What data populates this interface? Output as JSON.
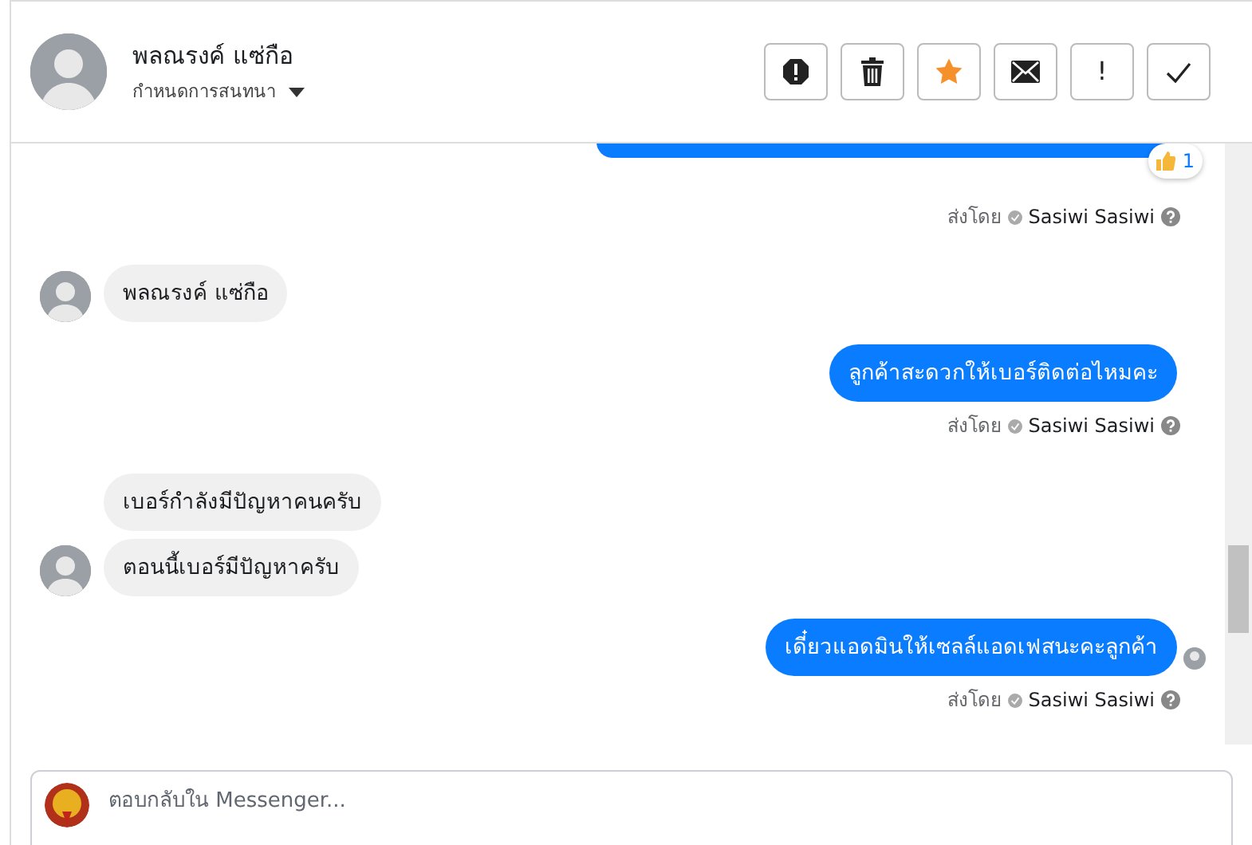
{
  "header": {
    "name": "พลณรงค์ แซ่กือ",
    "subtitle": "กำหนดการสนทนา",
    "actions": [
      {
        "kind": "alert"
      },
      {
        "kind": "trash"
      },
      {
        "kind": "star"
      },
      {
        "kind": "envelope"
      },
      {
        "kind": "text",
        "label": "!"
      },
      {
        "kind": "check"
      }
    ]
  },
  "messages": [
    {
      "kind": "outgoing_cut",
      "reaction": {
        "count": "1"
      },
      "sent_by": {
        "label": "ส่งโดย",
        "name": "Sasiwi Sasiwi"
      }
    },
    {
      "kind": "incoming",
      "text": "พลณรงค์  แซ่กือ",
      "avatar": true
    },
    {
      "kind": "outgoing",
      "text": "ลูกค้าสะดวกให้เบอร์ติดต่อไหมคะ",
      "seen": false,
      "sent_by": {
        "label": "ส่งโดย",
        "name": "Sasiwi Sasiwi"
      }
    },
    {
      "kind": "incoming",
      "text": "เบอร์กำลังมีปัญหาคนครับ",
      "avatar": false
    },
    {
      "kind": "incoming",
      "text": "ตอนนี้เบอร์มีปัญหาครับ",
      "avatar": true
    },
    {
      "kind": "outgoing",
      "text": "เดี๋ยวแอดมินให้เซลล์แอดเฟสนะคะลูกค้า",
      "seen": true,
      "sent_by": {
        "label": "ส่งโดย",
        "name": "Sasiwi Sasiwi"
      }
    }
  ],
  "composer": {
    "placeholder": "ตอบกลับใน Messenger..."
  }
}
